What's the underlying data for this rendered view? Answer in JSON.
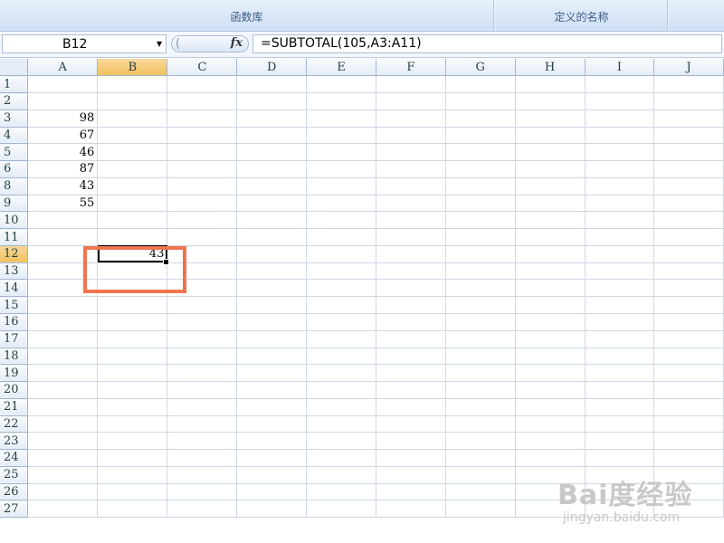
{
  "ribbon": {
    "groups": [
      {
        "label": "函数库"
      },
      {
        "label": "定义的名称"
      }
    ]
  },
  "formula_bar": {
    "name_box": "B12",
    "formula": "=SUBTOTAL(105,A3:A11)",
    "fx_label": "fx"
  },
  "sheet": {
    "columns": [
      "A",
      "B",
      "C",
      "D",
      "E",
      "F",
      "G",
      "H",
      "I",
      "J"
    ],
    "active_column": "B",
    "rows": [
      {
        "n": "1",
        "A": "",
        "B": ""
      },
      {
        "n": "2",
        "A": "",
        "B": ""
      },
      {
        "n": "3",
        "A": "98",
        "B": ""
      },
      {
        "n": "4",
        "A": "67",
        "B": ""
      },
      {
        "n": "5",
        "A": "46",
        "B": ""
      },
      {
        "n": "6",
        "A": "87",
        "B": ""
      },
      {
        "n": "8",
        "A": "43",
        "B": ""
      },
      {
        "n": "9",
        "A": "55",
        "B": ""
      },
      {
        "n": "10",
        "A": "",
        "B": ""
      },
      {
        "n": "11",
        "A": "",
        "B": ""
      },
      {
        "n": "12",
        "A": "",
        "B": "43"
      },
      {
        "n": "13",
        "A": "",
        "B": ""
      },
      {
        "n": "14",
        "A": "",
        "B": ""
      },
      {
        "n": "15",
        "A": "",
        "B": ""
      },
      {
        "n": "16",
        "A": "",
        "B": ""
      },
      {
        "n": "17",
        "A": "",
        "B": ""
      },
      {
        "n": "18",
        "A": "",
        "B": ""
      },
      {
        "n": "19",
        "A": "",
        "B": ""
      },
      {
        "n": "20",
        "A": "",
        "B": ""
      },
      {
        "n": "21",
        "A": "",
        "B": ""
      },
      {
        "n": "22",
        "A": "",
        "B": ""
      },
      {
        "n": "23",
        "A": "",
        "B": ""
      },
      {
        "n": "24",
        "A": "",
        "B": ""
      },
      {
        "n": "25",
        "A": "",
        "B": ""
      },
      {
        "n": "26",
        "A": "",
        "B": ""
      },
      {
        "n": "27",
        "A": "",
        "B": ""
      }
    ]
  },
  "watermark": {
    "brand": "Bai度经验",
    "url": "jingyan.baidu.com"
  },
  "colors": {
    "annotation": "#f0754f",
    "active_header": "#f1c15f"
  }
}
